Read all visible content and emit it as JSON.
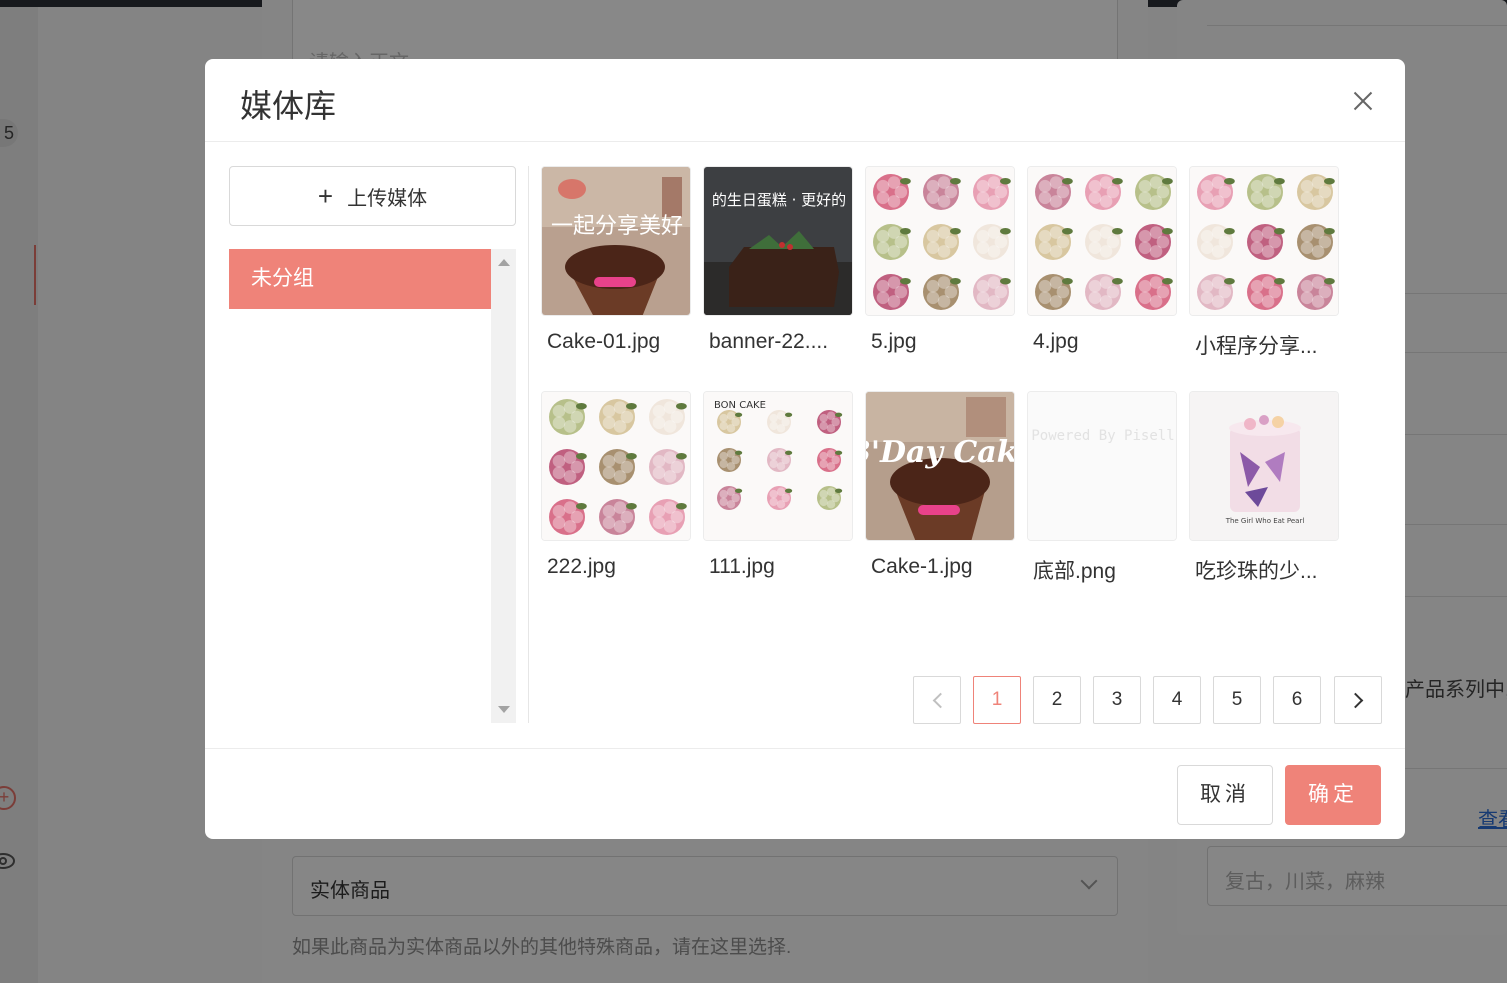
{
  "background": {
    "left_nav_badge": "5",
    "top_field_placeholder": "请输入正文",
    "product_type_value": "实体商品",
    "product_type_hint": "如果此商品为实体商品以外的其他特殊商品，请在这里选择.",
    "right_text_partial": "产品系列中,",
    "right_link_partial": "查看",
    "right_input_placeholder": "复古，川菜，麻辣"
  },
  "modal": {
    "title": "媒体库",
    "upload_label": "上传媒体",
    "groups": [
      {
        "label": "未分组",
        "selected": true
      }
    ],
    "media": [
      {
        "name": "Cake-01.jpg",
        "thumb": "cake-promo-pink",
        "overlay_text": "一起分享美好"
      },
      {
        "name": "banner-22....",
        "thumb": "dark-cake-banner",
        "overlay_text": "的生日蛋糕 · 更好的"
      },
      {
        "name": "5.jpg",
        "thumb": "flower-cupcakes"
      },
      {
        "name": "4.jpg",
        "thumb": "flower-cupcakes"
      },
      {
        "name": "小程序分享...",
        "thumb": "flower-cupcakes"
      },
      {
        "name": "222.jpg",
        "thumb": "flower-cupcakes"
      },
      {
        "name": "111.jpg",
        "thumb": "flower-cupcakes-bon",
        "overlay_text": "BON CAKE"
      },
      {
        "name": "Cake-1.jpg",
        "thumb": "bday-cake-promo",
        "overlay_text": "B'Day Cake"
      },
      {
        "name": "底部.png",
        "thumb": "powered-by-pisell",
        "overlay_text": "Powered By Pisell"
      },
      {
        "name": "吃珍珠的少...",
        "thumb": "floral-tall-cake",
        "overlay_text": "The Girl Who Eat Pearl"
      }
    ],
    "pagination": {
      "pages": [
        "1",
        "2",
        "3",
        "4",
        "5",
        "6"
      ],
      "current": "1"
    },
    "cancel_label": "取消",
    "confirm_label": "确定"
  },
  "colors": {
    "accent": "#ef8379",
    "overlay": "rgba(0,0,0,0.45)"
  }
}
